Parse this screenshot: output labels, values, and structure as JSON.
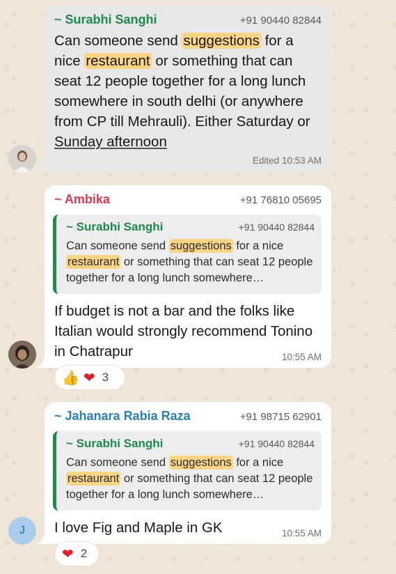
{
  "colors": {
    "sender1": "#1e8a4c",
    "sender2": "#d93a52",
    "sender3": "#2b7fb8",
    "highlight": "#fbd485"
  },
  "messages": [
    {
      "sender": "~ Surabhi Sanghi",
      "phone": "+91 90440 82844",
      "text_parts": [
        "Can someone send ",
        "suggestions",
        " for a nice ",
        "restaurant",
        " or something that can seat 12 people together for a long lunch somewhere in south delhi (or anywhere from CP till Mehrauli). Either Saturday or ",
        "Sunday afternoon"
      ],
      "status": "Edited",
      "time": "10:53 AM"
    },
    {
      "sender": "~ Ambika",
      "phone": "+91 76810 05695",
      "quote": {
        "sender": "~ Surabhi Sanghi",
        "phone": "+91 90440 82844",
        "parts": [
          "Can someone send ",
          "suggestions",
          " for a nice ",
          "restaurant",
          " or something that can seat 12 people together for a long lunch somewhere…"
        ]
      },
      "text": "If budget is not a bar and the folks like Italian would strongly recommend Tonino in Chatrapur",
      "time": "10:55 AM",
      "reactions": {
        "emojis": [
          "thumbs-up",
          "heart"
        ],
        "count": "3"
      }
    },
    {
      "sender": "~ Jahanara Rabia Raza",
      "phone": "+91 98715 62901",
      "avatar_initial": "J",
      "quote": {
        "sender": "~ Surabhi Sanghi",
        "phone": "+91 90440 82844",
        "parts": [
          "Can someone send ",
          "suggestions",
          " for a nice ",
          "restaurant",
          " or something that can seat 12 people together for a long lunch somewhere…"
        ]
      },
      "text": "I love Fig and Maple in GK",
      "time": "10:55 AM",
      "reactions": {
        "emojis": [
          "heart"
        ],
        "count": "2"
      }
    }
  ]
}
